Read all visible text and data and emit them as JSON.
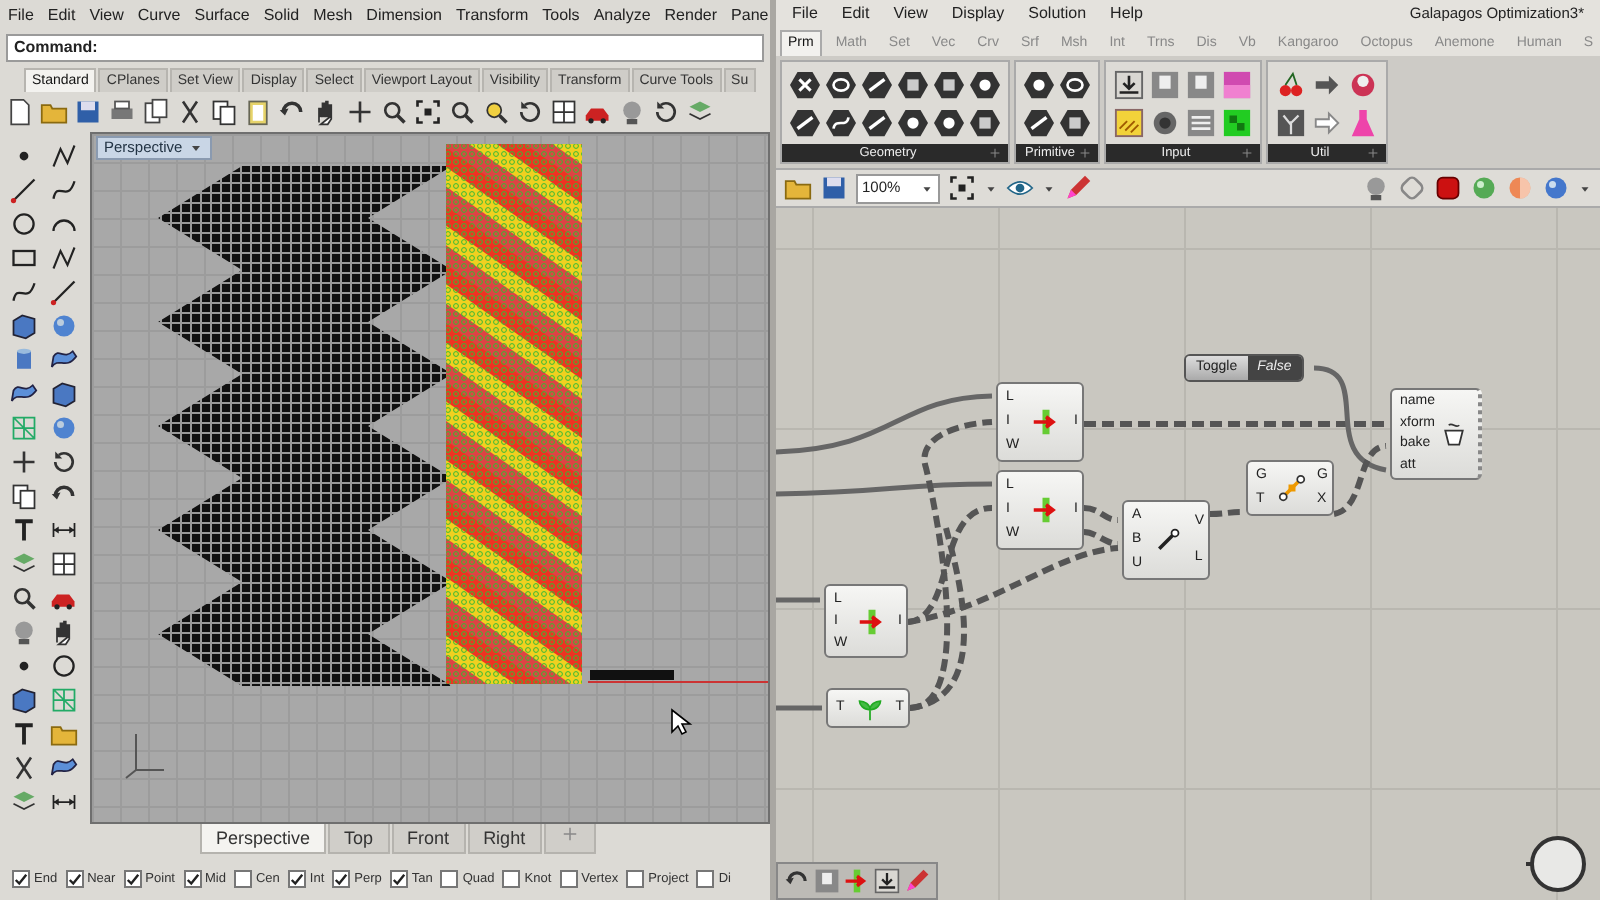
{
  "rhino": {
    "menu": [
      "File",
      "Edit",
      "View",
      "Curve",
      "Surface",
      "Solid",
      "Mesh",
      "Dimension",
      "Transform",
      "Tools",
      "Analyze",
      "Render",
      "Pane"
    ],
    "command": {
      "label": "Command:"
    },
    "toolbar_tabs": [
      {
        "label": "Standard",
        "selected": true
      },
      {
        "label": "CPlanes",
        "selected": false
      },
      {
        "label": "Set View",
        "selected": false
      },
      {
        "label": "Display",
        "selected": false
      },
      {
        "label": "Select",
        "selected": false
      },
      {
        "label": "Viewport Layout",
        "selected": false
      },
      {
        "label": "Visibility",
        "selected": false
      },
      {
        "label": "Transform",
        "selected": false
      },
      {
        "label": "Curve Tools",
        "selected": false
      },
      {
        "label": "Su",
        "selected": false
      }
    ],
    "viewport": {
      "title": "Perspective"
    },
    "viewport_tabs": [
      {
        "label": "Perspective",
        "selected": true
      },
      {
        "label": "Top",
        "selected": false
      },
      {
        "label": "Front",
        "selected": false
      },
      {
        "label": "Right",
        "selected": false
      }
    ],
    "osnaps": [
      {
        "label": "End",
        "checked": true
      },
      {
        "label": "Near",
        "checked": true
      },
      {
        "label": "Point",
        "checked": true
      },
      {
        "label": "Mid",
        "checked": true
      },
      {
        "label": "Cen",
        "checked": false
      },
      {
        "label": "Int",
        "checked": true
      },
      {
        "label": "Perp",
        "checked": true
      },
      {
        "label": "Tan",
        "checked": true
      },
      {
        "label": "Quad",
        "checked": false
      },
      {
        "label": "Knot",
        "checked": false
      },
      {
        "label": "Vertex",
        "checked": false
      },
      {
        "label": "Project",
        "checked": false
      },
      {
        "label": "Di",
        "checked": false
      }
    ]
  },
  "grasshopper": {
    "menu": [
      "File",
      "Edit",
      "View",
      "Display",
      "Solution",
      "Help"
    ],
    "title": "Galapagos Optimization3*",
    "tabs": [
      {
        "label": "Prm",
        "selected": true
      },
      {
        "label": "Math",
        "selected": false
      },
      {
        "label": "Set",
        "selected": false
      },
      {
        "label": "Vec",
        "selected": false
      },
      {
        "label": "Crv",
        "selected": false
      },
      {
        "label": "Srf",
        "selected": false
      },
      {
        "label": "Msh",
        "selected": false
      },
      {
        "label": "Int",
        "selected": false
      },
      {
        "label": "Trns",
        "selected": false
      },
      {
        "label": "Dis",
        "selected": false
      },
      {
        "label": "Vb",
        "selected": false
      },
      {
        "label": "Kangaroo",
        "selected": false
      },
      {
        "label": "Octopus",
        "selected": false
      },
      {
        "label": "Anemone",
        "selected": false
      },
      {
        "label": "Human",
        "selected": false
      },
      {
        "label": "S",
        "selected": false
      }
    ],
    "panels": [
      {
        "label": "Geometry"
      },
      {
        "label": "Primitive"
      },
      {
        "label": "Input"
      },
      {
        "label": "Util"
      }
    ],
    "zoom": "100%",
    "nodes": [
      {
        "kind": "toggle",
        "label": "Toggle",
        "value": "False"
      },
      {
        "kind": "component",
        "inputs": [
          "L",
          "I",
          "W"
        ],
        "outputs": [
          "I"
        ]
      },
      {
        "kind": "bake",
        "inputs": [
          "name",
          "xform",
          "bake",
          "att"
        ]
      },
      {
        "kind": "component",
        "inputs": [
          "L",
          "I",
          "W"
        ],
        "outputs": [
          "I"
        ]
      },
      {
        "kind": "component",
        "inputs": [
          "G",
          "T"
        ],
        "outputs": [
          "G",
          "X"
        ]
      },
      {
        "kind": "component",
        "inputs": [
          "A",
          "B",
          "U"
        ],
        "outputs": [
          "V",
          "L"
        ]
      },
      {
        "kind": "component",
        "inputs": [
          "L",
          "I",
          "W"
        ],
        "outputs": [
          "I"
        ]
      },
      {
        "kind": "component",
        "inputs": [
          "T"
        ],
        "outputs": [
          "T"
        ]
      }
    ]
  }
}
